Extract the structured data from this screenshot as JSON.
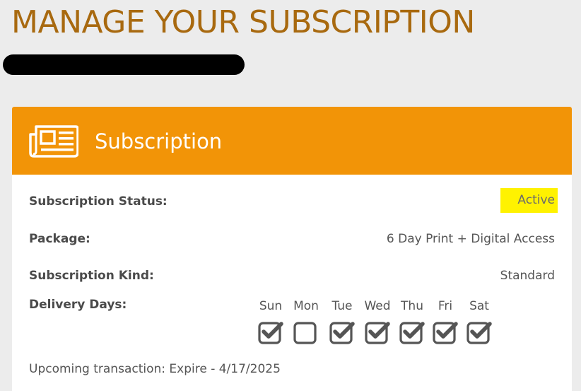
{
  "page": {
    "title": "MANAGE YOUR SUBSCRIPTION"
  },
  "card": {
    "icon": "newspaper-icon",
    "title": "Subscription"
  },
  "fields": {
    "status": {
      "label": "Subscription Status:",
      "value": "Active"
    },
    "package": {
      "label": "Package:",
      "value": "6 Day Print + Digital Access"
    },
    "kind": {
      "label": "Subscription Kind:",
      "value": "Standard"
    },
    "delivery": {
      "label": "Delivery Days:"
    }
  },
  "delivery_days": [
    {
      "name": "Sun",
      "checked": true
    },
    {
      "name": "Mon",
      "checked": false
    },
    {
      "name": "Tue",
      "checked": true
    },
    {
      "name": "Wed",
      "checked": true
    },
    {
      "name": "Thu",
      "checked": true
    },
    {
      "name": "Fri",
      "checked": true
    },
    {
      "name": "Sat",
      "checked": true
    }
  ],
  "upcoming": "Upcoming transaction: Expire - 4/17/2025",
  "colors": {
    "title": "#a8690f",
    "header": "#f29407",
    "status_highlight": "#fff200"
  }
}
